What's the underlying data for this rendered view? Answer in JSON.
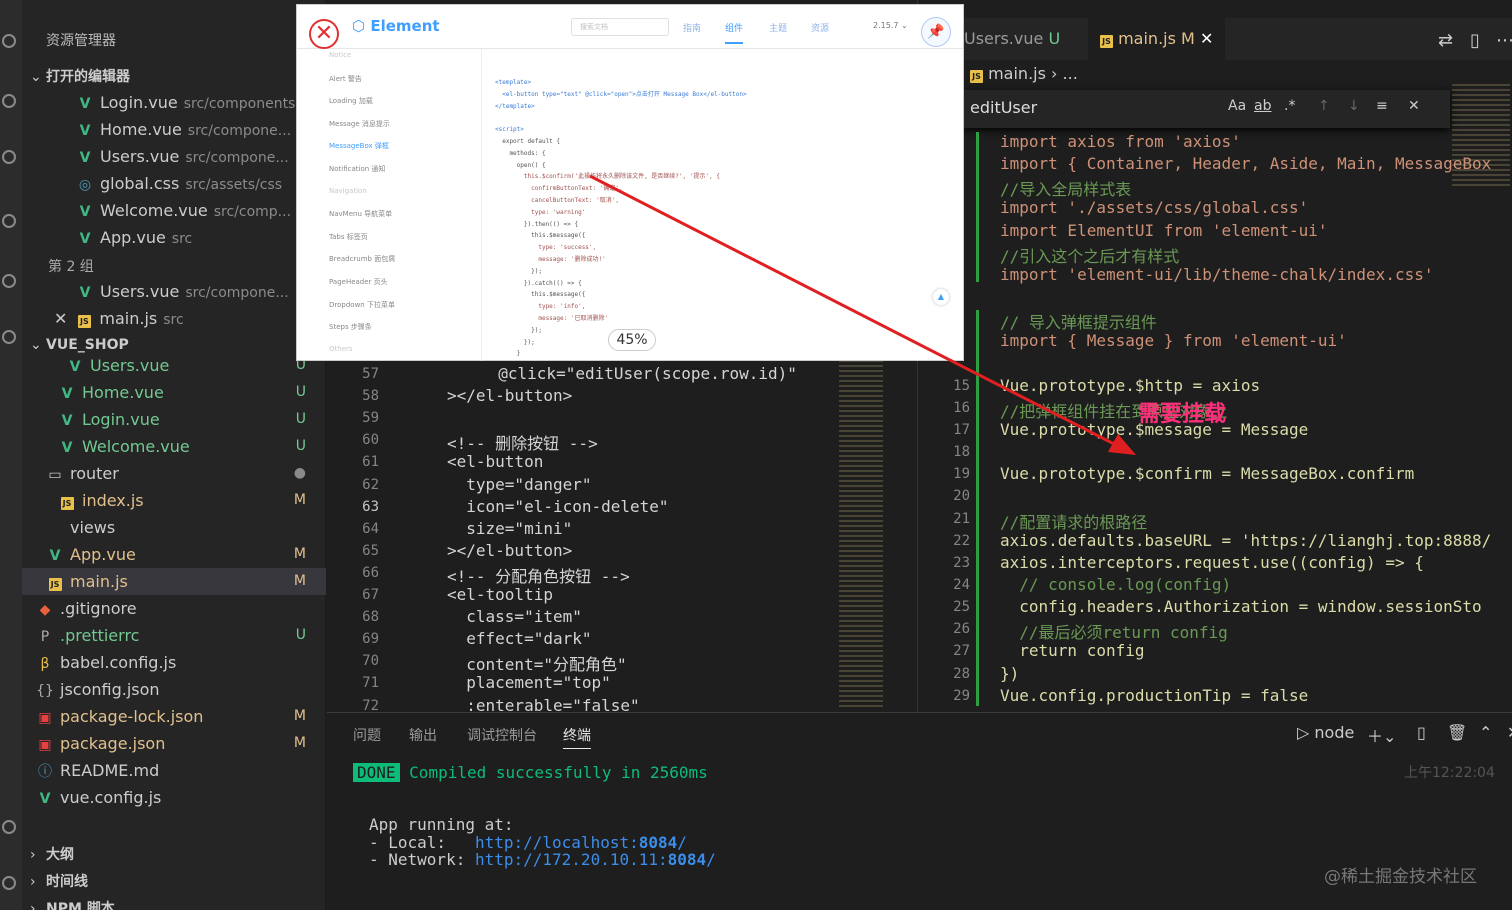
{
  "colors": {
    "accent": "#409eff",
    "vue": "#41b883",
    "modified": "#e2c08d",
    "untracked": "#73c991",
    "annotation": "#ff2d7a",
    "arrow": "#e02020"
  },
  "sidebar": {
    "title": "资源管理器",
    "open_editors_label": "打开的编辑器",
    "open_editors": [
      {
        "name": "Login.vue",
        "path": "src/components",
        "icon": "vue-icon"
      },
      {
        "name": "Home.vue",
        "path": "src/compone...",
        "icon": "vue-icon"
      },
      {
        "name": "Users.vue",
        "path": "src/compone...",
        "icon": "vue-icon"
      },
      {
        "name": "global.css",
        "path": "src/assets/css",
        "icon": "css-icon"
      },
      {
        "name": "Welcome.vue",
        "path": "src/comp...",
        "icon": "vue-icon"
      },
      {
        "name": "App.vue",
        "path": "src",
        "icon": "vue-icon"
      }
    ],
    "group2_label": "第 2 组",
    "group2": [
      {
        "name": "Users.vue",
        "path": "src/compone...",
        "icon": "vue-icon"
      },
      {
        "name": "main.js",
        "path": "src",
        "icon": "js-icon",
        "close": "✕"
      }
    ],
    "project_label": "VUE_SHOP",
    "tree": [
      {
        "name": "Users.vue",
        "badge": "U",
        "icon": "vue-icon"
      },
      {
        "name": "Home.vue",
        "badge": "U",
        "icon": "vue-icon"
      },
      {
        "name": "Login.vue",
        "badge": "U",
        "icon": "vue-icon"
      },
      {
        "name": "Welcome.vue",
        "badge": "U",
        "icon": "vue-icon"
      },
      {
        "name": "router",
        "badge": "●",
        "icon": "folder-icon"
      },
      {
        "name": "index.js",
        "badge": "M",
        "icon": "js-icon"
      },
      {
        "name": "views",
        "badge": "",
        "icon": ""
      },
      {
        "name": "App.vue",
        "badge": "M",
        "icon": "vue-icon"
      },
      {
        "name": "main.js",
        "badge": "M",
        "icon": "js-icon"
      },
      {
        "name": ".gitignore",
        "badge": "",
        "icon": "git-icon"
      },
      {
        "name": ".prettierrc",
        "badge": "U",
        "icon": "prettier-icon"
      },
      {
        "name": "babel.config.js",
        "badge": "",
        "icon": "babel-icon"
      },
      {
        "name": "jsconfig.json",
        "badge": "",
        "icon": "json-icon"
      },
      {
        "name": "package-lock.json",
        "badge": "M",
        "icon": "npm-icon"
      },
      {
        "name": "package.json",
        "badge": "M",
        "icon": "npm-icon"
      },
      {
        "name": "README.md",
        "badge": "",
        "icon": "info-icon"
      },
      {
        "name": "vue.config.js",
        "badge": "",
        "icon": "vue-icon"
      }
    ],
    "outline_label": "大纲",
    "timeline_label": "时间线",
    "npm_label": "NPM 脚本"
  },
  "left_editor": {
    "current_line": "63",
    "lines": [
      {
        "n": "57",
        "text": "  @click=\"editUser(scope.row.id)\""
      },
      {
        "n": "58",
        "text": "></el-button>"
      },
      {
        "n": "59",
        "text": ""
      },
      {
        "n": "60",
        "text": "<!-- 删除按钮 -->"
      },
      {
        "n": "61",
        "text": "<el-button"
      },
      {
        "n": "62",
        "text": "  type=\"danger\""
      },
      {
        "n": "63",
        "text": "  icon=\"el-icon-delete\""
      },
      {
        "n": "64",
        "text": "  size=\"mini\""
      },
      {
        "n": "65",
        "text": "></el-button>"
      },
      {
        "n": "66",
        "text": "<!-- 分配角色按钮 -->"
      },
      {
        "n": "67",
        "text": "<el-tooltip"
      },
      {
        "n": "68",
        "text": "  class=\"item\""
      },
      {
        "n": "69",
        "text": "  effect=\"dark\""
      },
      {
        "n": "70",
        "text": "  content=\"分配角色\""
      },
      {
        "n": "71",
        "text": "  placement=\"top\""
      },
      {
        "n": "72",
        "text": "  :enterable=\"false\""
      }
    ]
  },
  "right_editor": {
    "tabs": [
      {
        "label": "Users.vue",
        "badge": "U"
      },
      {
        "label": "main.js",
        "badge": "M",
        "close": "✕"
      }
    ],
    "breadcrumb": [
      "main.js",
      "..."
    ],
    "find_value": "editUser",
    "find_case": "Aa",
    "find_word": "ab",
    "find_regex": ".*",
    "lines": [
      {
        "n": "",
        "text": "import axios from 'axios'"
      },
      {
        "n": "",
        "text": "import { Container, Header, Aside, Main, MessageBox"
      },
      {
        "n": "",
        "text": "//导入全局样式表"
      },
      {
        "n": "",
        "text": "import './assets/css/global.css'"
      },
      {
        "n": "",
        "text": "import ElementUI from 'element-ui'"
      },
      {
        "n": "",
        "text": "//引入这个之后才有样式"
      },
      {
        "n": "",
        "text": "import 'element-ui/lib/theme-chalk/index.css'"
      },
      {
        "n": "",
        "text": ""
      },
      {
        "n": "",
        "text": "// 导入弹框提示组件"
      },
      {
        "n": "",
        "text": "import { Message } from 'element-ui'"
      },
      {
        "n": "",
        "text": ""
      },
      {
        "n": "15",
        "text": "Vue.prototype.$http = axios"
      },
      {
        "n": "16",
        "text": "//把弹框组件挂在到原型对象上"
      },
      {
        "n": "17",
        "text": "Vue.prototype.$message = Message"
      },
      {
        "n": "18",
        "text": ""
      },
      {
        "n": "19",
        "text": "Vue.prototype.$confirm = MessageBox.confirm"
      },
      {
        "n": "20",
        "text": ""
      },
      {
        "n": "21",
        "text": "//配置请求的根路径"
      },
      {
        "n": "22",
        "text": "axios.defaults.baseURL = 'https://lianghj.top:8888/"
      },
      {
        "n": "23",
        "text": "axios.interceptors.request.use((config) => {"
      },
      {
        "n": "24",
        "text": "  // console.log(config)"
      },
      {
        "n": "25",
        "text": "  config.headers.Authorization = window.sessionSto"
      },
      {
        "n": "26",
        "text": "  //最后必须return config"
      },
      {
        "n": "27",
        "text": "  return config"
      },
      {
        "n": "28",
        "text": "})"
      },
      {
        "n": "29",
        "text": "Vue.config.productionTip = false"
      }
    ],
    "annotation": "需要挂载"
  },
  "panel": {
    "tabs": [
      "问题",
      "输出",
      "调试控制台",
      "终端"
    ],
    "active_tab": "终端",
    "terminal_name": "node",
    "done": "DONE",
    "compiled": "Compiled successfully in 2560ms",
    "time": "上午12:22:04",
    "running": "App running at:",
    "local_label": "- Local:   ",
    "local_url_pre": "http://localhost:",
    "local_port": "8084",
    "network_label": "- Network: ",
    "network_url_pre": "http://172.20.10.11:",
    "network_port": "8084"
  },
  "popup": {
    "logo": "Element",
    "search_placeholder": "搜索文档",
    "nav": [
      "指南",
      "组件",
      "主题",
      "资源"
    ],
    "active_nav": "组件",
    "version": "2.15.7",
    "zoom": "45%",
    "side_items": [
      {
        "t": "Notice",
        "hd": true
      },
      {
        "t": "Alert 警告"
      },
      {
        "t": "Loading 加载"
      },
      {
        "t": "Message 消息提示"
      },
      {
        "t": "MessageBox 弹框",
        "act": true
      },
      {
        "t": "Notification 通知"
      },
      {
        "t": "Navigation",
        "hd": true
      },
      {
        "t": "NavMenu 导航菜单"
      },
      {
        "t": "Tabs 标签页"
      },
      {
        "t": "Breadcrumb 面包屑"
      },
      {
        "t": "PageHeader 页头"
      },
      {
        "t": "Dropdown 下拉菜单"
      },
      {
        "t": "Steps 步骤条"
      },
      {
        "t": "Others",
        "hd": true
      }
    ],
    "code_lines": [
      "<template>",
      "  <el-button type=\"text\" @click=\"open\">点击打开 Message Box</el-button>",
      "</template>",
      "",
      "<script>",
      "  export default {",
      "    methods: {",
      "      open() {",
      "        this.$confirm('此操作将永久删除该文件, 是否继续?', '提示', {",
      "          confirmButtonText: '确定',",
      "          cancelButtonText: '取消',",
      "          type: 'warning'",
      "        }).then(() => {",
      "          this.$message({",
      "            type: 'success',",
      "            message: '删除成功!'",
      "          });",
      "        }).catch(() => {",
      "          this.$message({",
      "            type: 'info',",
      "            message: '已取消删除'",
      "          });",
      "        });",
      "      }"
    ]
  },
  "watermark": "@稀土掘金技术社区"
}
